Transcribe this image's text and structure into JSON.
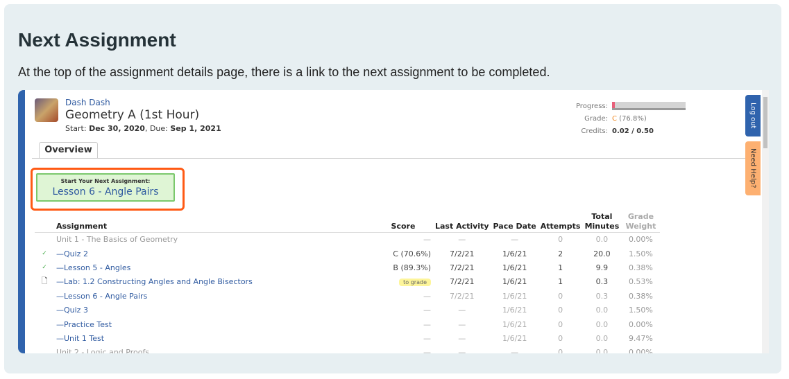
{
  "heading": "Next Assignment",
  "description": "At the top of the assignment details page, there is a link to the next assignment to be completed.",
  "student": "Dash Dash",
  "course": "Geometry A (1st Hour)",
  "dates": {
    "start_label": "Start:",
    "start": "Dec 30, 2020",
    "due_label": ", Due:",
    "due": "Sep 1, 2021"
  },
  "stats": {
    "progress_label": "Progress:",
    "progress_percent": 4,
    "grade_label": "Grade:",
    "grade_letter": "C",
    "grade_pct": "(76.8%)",
    "credits_label": "Credits:",
    "credits": "0.02 / 0.50"
  },
  "tab": "Overview",
  "next": {
    "label": "Start Your Next Assignment:",
    "assignment": "Lesson 6 - Angle Pairs"
  },
  "side": {
    "logout": "Log out",
    "help": "Need Help?"
  },
  "colors": {
    "accent": "#2f63ad",
    "highlight": "#ff5a14",
    "help": "#fdb071"
  },
  "columns": [
    "Assignment",
    "Score",
    "Last Activity",
    "Pace Date",
    "Attempts",
    "Total Minutes",
    "Grade Weight"
  ],
  "rows": [
    {
      "type": "unit",
      "name": "Unit 1 - The Basics of Geometry",
      "score": "—",
      "last": "—",
      "pace": "—",
      "attempts": "0",
      "minutes": "0.0",
      "weight": "0.00%"
    },
    {
      "type": "done",
      "icon": "check",
      "name": "—Quiz 2",
      "score": "C (70.6%)",
      "last": "7/2/21",
      "pace": "1/6/21",
      "attempts": "2",
      "minutes": "20.0",
      "weight": "1.50%"
    },
    {
      "type": "done",
      "icon": "check",
      "name": "—Lesson 5 - Angles",
      "score": "B (89.3%)",
      "last": "7/2/21",
      "pace": "1/6/21",
      "attempts": "1",
      "minutes": "9.9",
      "weight": "0.38%"
    },
    {
      "type": "done",
      "icon": "doc",
      "name": "—Lab: 1.2 Constructing Angles and Angle Bisectors",
      "score": "to grade",
      "last": "7/2/21",
      "pace": "1/6/21",
      "attempts": "1",
      "minutes": "0.3",
      "weight": "0.53%"
    },
    {
      "type": "pending",
      "name": "—Lesson 6 - Angle Pairs",
      "score": "—",
      "last": "7/2/21",
      "pace": "1/6/21",
      "attempts": "0",
      "minutes": "0.3",
      "weight": "0.38%"
    },
    {
      "type": "pending",
      "name": "—Quiz 3",
      "score": "—",
      "last": "—",
      "pace": "1/6/21",
      "attempts": "0",
      "minutes": "0.0",
      "weight": "1.50%"
    },
    {
      "type": "pending",
      "name": "—Practice Test",
      "score": "—",
      "last": "—",
      "pace": "1/6/21",
      "attempts": "0",
      "minutes": "0.0",
      "weight": "0.00%"
    },
    {
      "type": "pending",
      "name": "—Unit 1 Test",
      "score": "—",
      "last": "—",
      "pace": "1/6/21",
      "attempts": "0",
      "minutes": "0.0",
      "weight": "9.47%"
    },
    {
      "type": "unit",
      "name": "Unit 2 - Logic and Proofs",
      "score": "—",
      "last": "—",
      "pace": "—",
      "attempts": "0",
      "minutes": "0.0",
      "weight": "0.00%"
    }
  ]
}
